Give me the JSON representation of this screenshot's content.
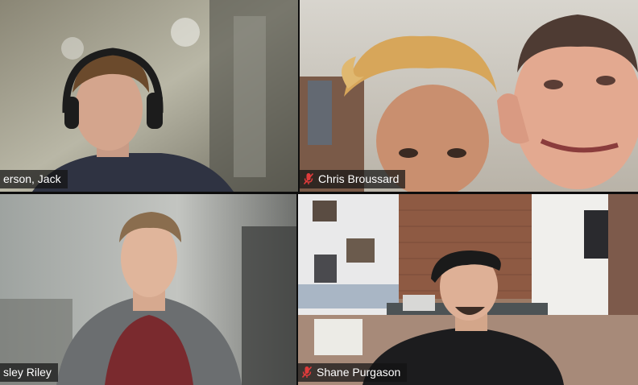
{
  "participants": [
    {
      "name": "erson, Jack",
      "muted": false,
      "active_speaker": true
    },
    {
      "name": "Chris Broussard",
      "muted": true,
      "active_speaker": false
    },
    {
      "name": "sley Riley",
      "muted": false,
      "active_speaker": false
    },
    {
      "name": "Shane Purgason",
      "muted": true,
      "active_speaker": false
    }
  ],
  "colors": {
    "active_border": "#d4e04a",
    "muted_icon": "#e03b3b",
    "name_tag_bg": "#141414"
  },
  "icons": {
    "muted": "mic-muted-icon"
  }
}
